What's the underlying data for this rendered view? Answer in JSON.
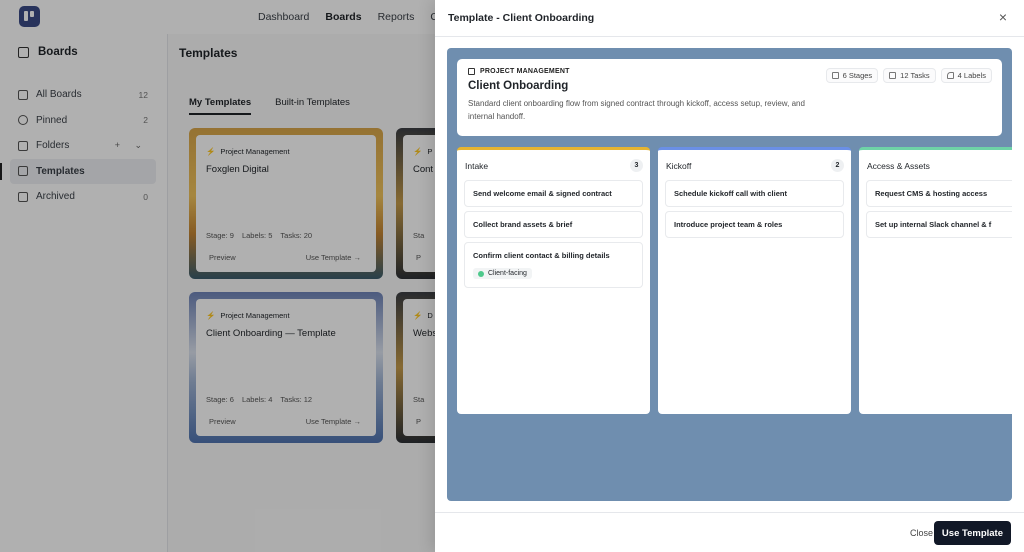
{
  "topnav": {
    "items": [
      "Dashboard",
      "Boards",
      "Reports",
      "Co"
    ],
    "active": "Boards"
  },
  "sidebar": {
    "title": "Boards",
    "items": [
      {
        "label": "All Boards",
        "count": "12"
      },
      {
        "label": "Pinned",
        "count": "2"
      },
      {
        "label": "Folders",
        "count": "+ ⌄"
      },
      {
        "label": "Templates",
        "count": ""
      },
      {
        "label": "Archived",
        "count": "0"
      }
    ]
  },
  "main": {
    "title": "Templates",
    "tabs": [
      "My Templates",
      "Built-in Templates"
    ],
    "cards": [
      {
        "category": "Project Management",
        "name": "Foxglen Digital",
        "stage": "Stage: 9",
        "labels": "Labels: 5",
        "tasks": "Tasks: 20",
        "preview": "Preview",
        "use": "Use Template →"
      },
      {
        "category": "Project Management",
        "name": "Client Onboarding — Template",
        "stage": "Stage: 6",
        "labels": "Labels: 4",
        "tasks": "Tasks: 12",
        "preview": "Preview",
        "use": "Use Template →"
      },
      {
        "category": "P",
        "name": "Cont",
        "stage": "Sta",
        "preview": "P"
      },
      {
        "category": "D",
        "name": "Webs",
        "stage": "Sta",
        "preview": "P"
      }
    ]
  },
  "modal": {
    "title": "Template - Client Onboarding",
    "close_icon": "×",
    "kicker": "PROJECT MANAGEMENT",
    "board_title": "Client Onboarding",
    "description": "Standard client onboarding flow from signed contract through kickoff, access setup, review, and internal handoff.",
    "chips": {
      "stages": "6 Stages",
      "tasks": "12 Tasks",
      "labels": "4 Labels"
    },
    "columns": [
      {
        "name": "Intake",
        "count": "3",
        "color": "#e5b431",
        "tasks": [
          "Send welcome email & signed contract",
          "Collect brand assets & brief",
          "Confirm client contact & billing details"
        ],
        "tag": "Client-facing",
        "tag_color": "#4ec98c"
      },
      {
        "name": "Kickoff",
        "count": "2",
        "color": "#6a8fe6",
        "tasks": [
          "Schedule kickoff call with client",
          "Introduce project team & roles"
        ]
      },
      {
        "name": "Access & Assets",
        "count": "",
        "color": "#6ed3a7",
        "tasks": [
          "Request CMS & hosting access",
          "Set up internal Slack channel & f"
        ]
      }
    ],
    "footer": {
      "close": "Close",
      "use": "Use Template"
    }
  }
}
